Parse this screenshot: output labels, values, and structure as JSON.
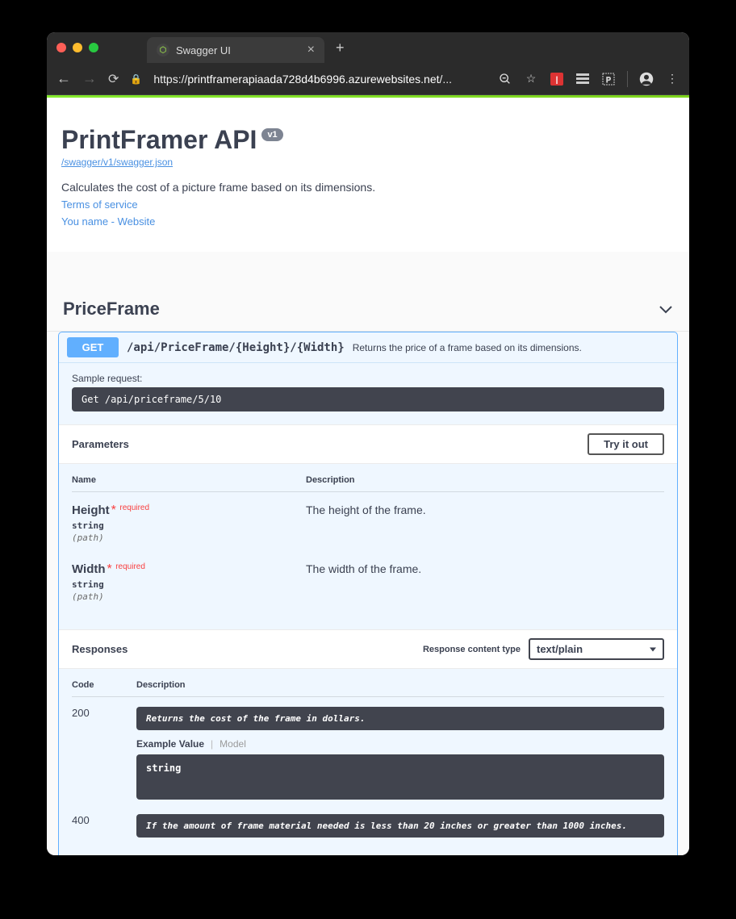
{
  "browser": {
    "tab_title": "Swagger UI",
    "url_prefix": "https://",
    "url_domain": "printframerapiaada728d4b6996.azurewebsites.net",
    "url_suffix": "/..."
  },
  "api": {
    "title": "PrintFramer API",
    "version": "v1",
    "swagger_url": "/swagger/v1/swagger.json",
    "description": "Calculates the cost of a picture frame based on its dimensions.",
    "terms_link": "Terms of service",
    "contact_link": "You name - Website"
  },
  "tag": {
    "name": "PriceFrame"
  },
  "operation": {
    "method": "GET",
    "path": "/api/PriceFrame/{Height}/{Width}",
    "summary": "Returns the price of a frame based on its dimensions.",
    "sample_label": "Sample request:",
    "sample_code": "Get /api/priceframe/5/10",
    "parameters_heading": "Parameters",
    "try_it_out": "Try it out",
    "param_headers": {
      "name": "Name",
      "desc": "Description"
    },
    "required_label": "required",
    "params": [
      {
        "name": "Height",
        "type": "string",
        "in": "(path)",
        "desc": "The height of the frame."
      },
      {
        "name": "Width",
        "type": "string",
        "in": "(path)",
        "desc": "The width of the frame."
      }
    ],
    "responses_heading": "Responses",
    "content_type_label": "Response content type",
    "content_type_value": "text/plain",
    "resp_headers": {
      "code": "Code",
      "desc": "Description"
    },
    "example_value_label": "Example Value",
    "model_label": "Model",
    "responses": [
      {
        "code": "200",
        "desc": "Returns the cost of the frame in dollars.",
        "example": "string"
      },
      {
        "code": "400",
        "desc": "If the amount of frame material needed is less than 20 inches or greater than 1000 inches."
      }
    ]
  }
}
